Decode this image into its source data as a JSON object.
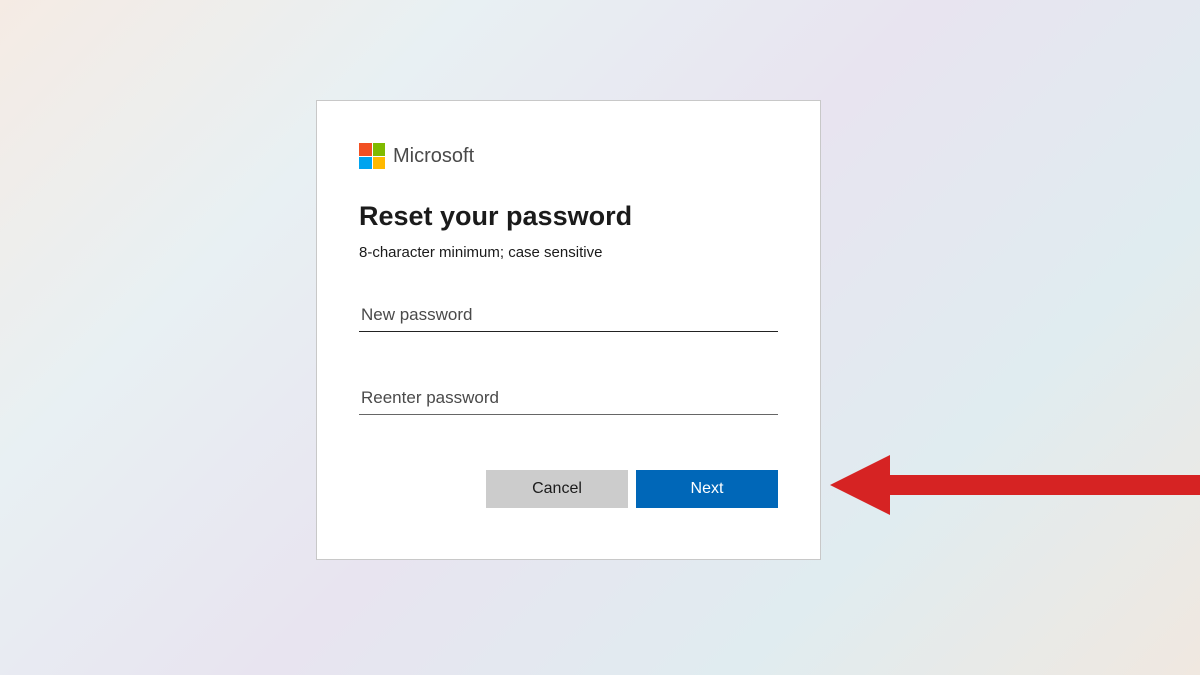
{
  "brand": {
    "name": "Microsoft",
    "logo_colors": {
      "top_left": "#f25022",
      "top_right": "#7fba00",
      "bottom_left": "#00a4ef",
      "bottom_right": "#ffb900"
    }
  },
  "dialog": {
    "heading": "Reset your password",
    "subtext": "8-character minimum; case sensitive",
    "new_password": {
      "placeholder": "New password",
      "value": ""
    },
    "reenter_password": {
      "placeholder": "Reenter password",
      "value": ""
    },
    "buttons": {
      "cancel": "Cancel",
      "next": "Next"
    }
  },
  "annotation": {
    "arrow_color": "#d62323"
  }
}
